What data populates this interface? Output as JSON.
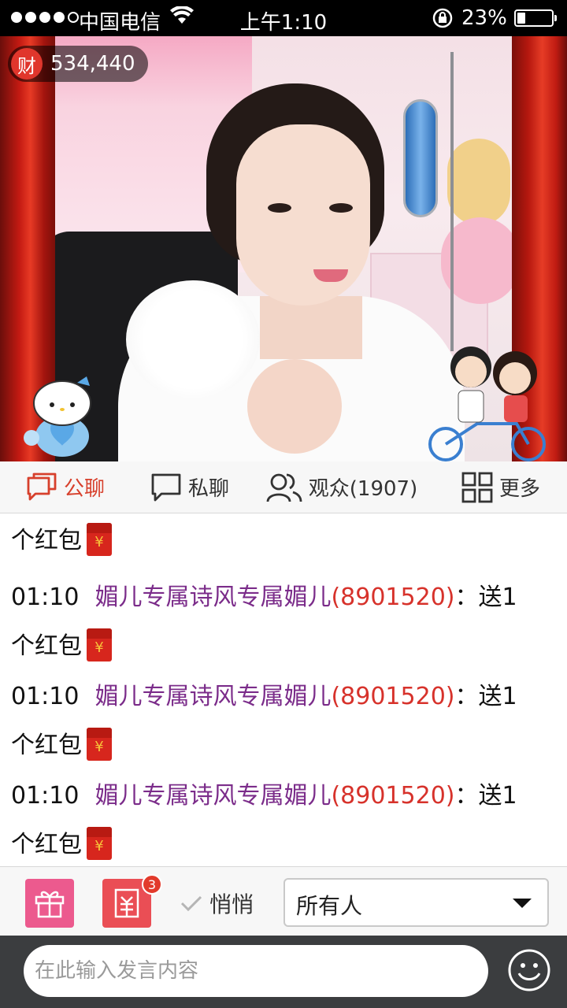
{
  "status_bar": {
    "carrier": "中国电信",
    "time": "上午1:10",
    "battery": "23%",
    "battery_level": 0.23
  },
  "video": {
    "wealth_badge": "财",
    "wealth_value": "534,440"
  },
  "tabs": [
    {
      "label": "公聊",
      "icon": "chat-bubble-icon",
      "active": true
    },
    {
      "label": "私聊",
      "icon": "private-chat-icon",
      "active": false
    },
    {
      "label": "观众(1907)",
      "icon": "audience-icon",
      "active": false
    },
    {
      "label": "更多",
      "icon": "grid-icon",
      "active": false
    }
  ],
  "chat": {
    "messages": [
      {
        "text": "个红包"
      },
      {
        "time": "01:10",
        "user": "媚儿专属诗风专属媚儿",
        "uid": "(8901520)",
        "text": "：送1",
        "text2": "个红包"
      },
      {
        "time": "01:10",
        "user": "媚儿专属诗风专属媚儿",
        "uid": "(8901520)",
        "text": "：送1",
        "text2": "个红包"
      },
      {
        "time": "01:10",
        "user": "媚儿专属诗风专属媚儿",
        "uid": "(8901520)",
        "text": "：送1",
        "text2": "个红包"
      }
    ],
    "envelope_glyph": "¥"
  },
  "controls": {
    "redpack_count": "3",
    "whisper_label": "悄悄",
    "recipient": "所有人"
  },
  "input": {
    "placeholder": "在此输入发言内容"
  },
  "colors": {
    "accent": "#d7402c",
    "username": "#7b2c8a",
    "uid": "#d7322b"
  }
}
